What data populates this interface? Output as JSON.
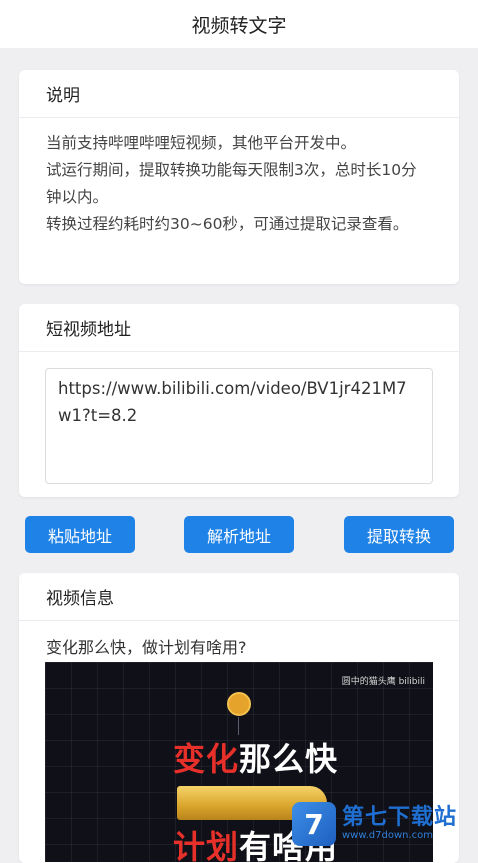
{
  "header": {
    "title": "视频转文字"
  },
  "info_card": {
    "title": "说明",
    "lines": [
      "当前支持哔哩哔哩短视频，其他平台开发中。",
      "试运行期间，提取转换功能每天限制3次，总时长10分钟以内。",
      "转换过程约耗时约30~60秒，可通过提取记录查看。"
    ]
  },
  "url_card": {
    "title": "短视频地址",
    "value": "https://www.bilibili.com/video/BV1jr421M7w1?t=8.2"
  },
  "actions": {
    "paste": "粘贴地址",
    "parse": "解析地址",
    "extract": "提取转换"
  },
  "video_card": {
    "title": "视频信息",
    "video_title": "变化那么快，做计划有啥用?",
    "thumbnail": {
      "uploader": "圆中的猫头鹰 bilibili",
      "line1_red": "变化",
      "line1_white": "那么快",
      "line2_red": "计划",
      "line2_white": "有啥用"
    }
  },
  "watermark": {
    "icon": "7",
    "main": "第七下载站",
    "sub": "www.d7down.com"
  },
  "colors": {
    "accent": "#1f82e6",
    "background": "#efeff1"
  }
}
